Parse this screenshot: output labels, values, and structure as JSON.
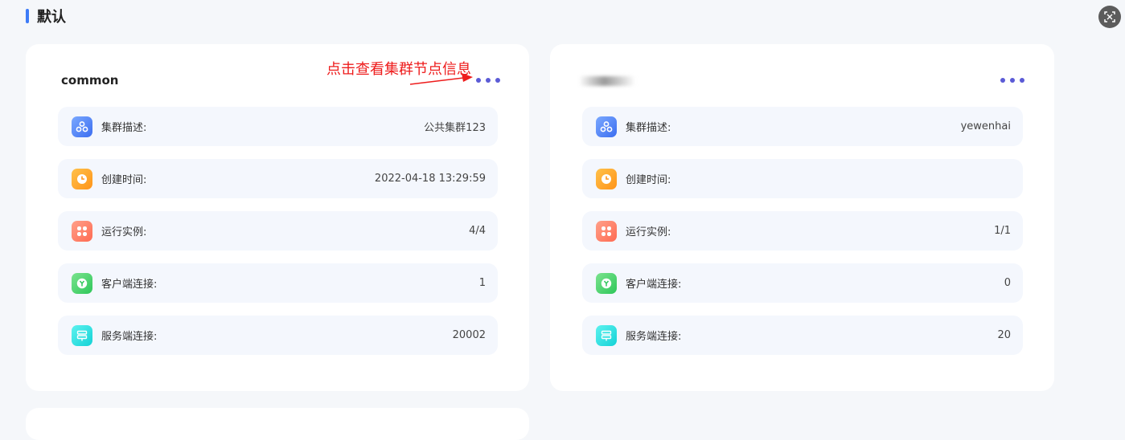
{
  "section": {
    "title": "默认"
  },
  "annotation": {
    "text": "点击查看集群节点信息",
    "color": "#ee1c1c"
  },
  "colors": {
    "accent": "#3d7bf7",
    "more_dots": "#5b5bd6"
  },
  "cards": [
    {
      "title": "common",
      "title_blurred": false,
      "rows": [
        {
          "icon": "cluster-icon",
          "label": "集群描述:",
          "value": "公共集群123"
        },
        {
          "icon": "clock-icon",
          "label": "创建时间:",
          "value": "2022-04-18 13:29:59"
        },
        {
          "icon": "instances-icon",
          "label": "运行实例:",
          "value": "4/4"
        },
        {
          "icon": "client-icon",
          "label": "客户端连接:",
          "value": "1"
        },
        {
          "icon": "server-icon",
          "label": "服务端连接:",
          "value": "20002"
        }
      ]
    },
    {
      "title": "",
      "title_blurred": true,
      "rows": [
        {
          "icon": "cluster-icon",
          "label": "集群描述:",
          "value": "yewenhai"
        },
        {
          "icon": "clock-icon",
          "label": "创建时间:",
          "value": ""
        },
        {
          "icon": "instances-icon",
          "label": "运行实例:",
          "value": "1/1"
        },
        {
          "icon": "client-icon",
          "label": "客户端连接:",
          "value": "0"
        },
        {
          "icon": "server-icon",
          "label": "服务端连接:",
          "value": "20"
        }
      ]
    }
  ]
}
